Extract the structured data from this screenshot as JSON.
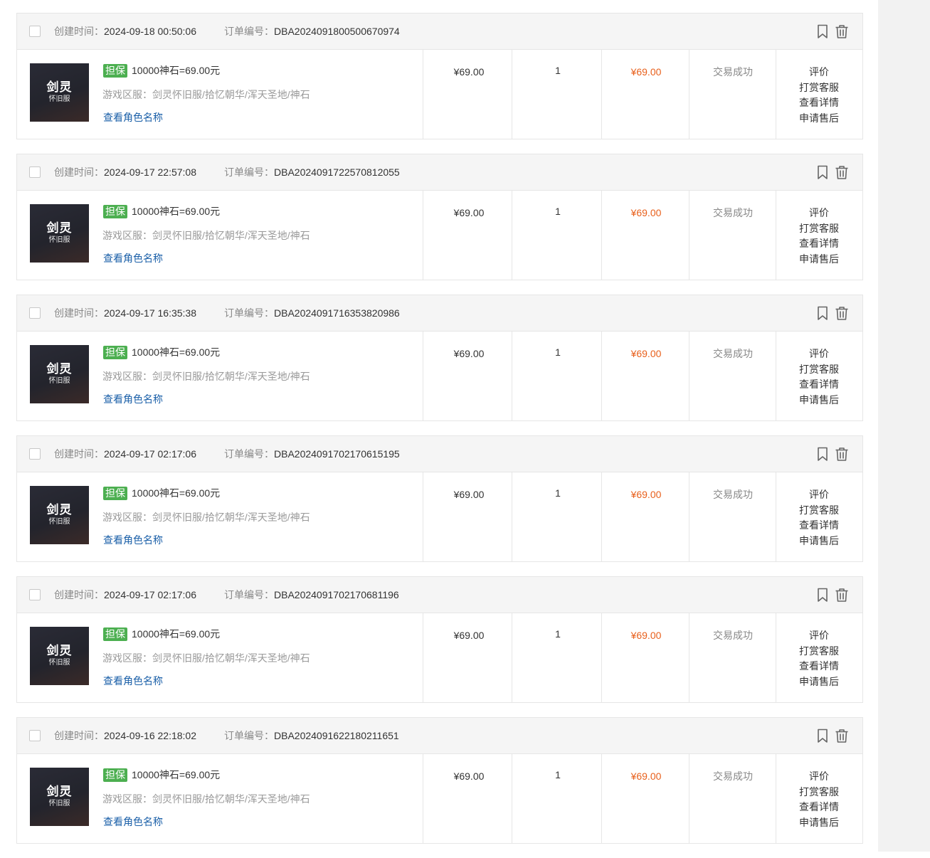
{
  "labels": {
    "created_time": "创建时间：",
    "order_number": "订单编号：",
    "guarantee_badge": "担保",
    "view_role_name": "查看角色名称"
  },
  "thumbnail": {
    "title": "剑灵",
    "subtitle": "怀旧服"
  },
  "actions": [
    "评价",
    "打赏客服",
    "查看详情",
    "申请售后"
  ],
  "icons": {
    "bookmark": "bookmark-icon",
    "delete": "trash-icon"
  },
  "colors": {
    "badge": "#4caf50",
    "total_price": "#e8601c",
    "link": "#1a5fa8"
  },
  "orders": [
    {
      "created_time": "2024-09-18 00:50:06",
      "order_number": "DBA2024091800500670974",
      "product": "10000神石=69.00元",
      "server": "游戏区服：剑灵怀旧服/拾忆朝华/浑天圣地/神石",
      "price": "¥69.00",
      "quantity": "1",
      "total": "¥69.00",
      "status": "交易成功"
    },
    {
      "created_time": "2024-09-17 22:57:08",
      "order_number": "DBA2024091722570812055",
      "product": "10000神石=69.00元",
      "server": "游戏区服：剑灵怀旧服/拾忆朝华/浑天圣地/神石",
      "price": "¥69.00",
      "quantity": "1",
      "total": "¥69.00",
      "status": "交易成功"
    },
    {
      "created_time": "2024-09-17 16:35:38",
      "order_number": "DBA2024091716353820986",
      "product": "10000神石=69.00元",
      "server": "游戏区服：剑灵怀旧服/拾忆朝华/浑天圣地/神石",
      "price": "¥69.00",
      "quantity": "1",
      "total": "¥69.00",
      "status": "交易成功"
    },
    {
      "created_time": "2024-09-17 02:17:06",
      "order_number": "DBA2024091702170615195",
      "product": "10000神石=69.00元",
      "server": "游戏区服：剑灵怀旧服/拾忆朝华/浑天圣地/神石",
      "price": "¥69.00",
      "quantity": "1",
      "total": "¥69.00",
      "status": "交易成功"
    },
    {
      "created_time": "2024-09-17 02:17:06",
      "order_number": "DBA2024091702170681196",
      "product": "10000神石=69.00元",
      "server": "游戏区服：剑灵怀旧服/拾忆朝华/浑天圣地/神石",
      "price": "¥69.00",
      "quantity": "1",
      "total": "¥69.00",
      "status": "交易成功"
    },
    {
      "created_time": "2024-09-16 22:18:02",
      "order_number": "DBA2024091622180211651",
      "product": "10000神石=69.00元",
      "server": "游戏区服：剑灵怀旧服/拾忆朝华/浑天圣地/神石",
      "price": "¥69.00",
      "quantity": "1",
      "total": "¥69.00",
      "status": "交易成功"
    }
  ]
}
